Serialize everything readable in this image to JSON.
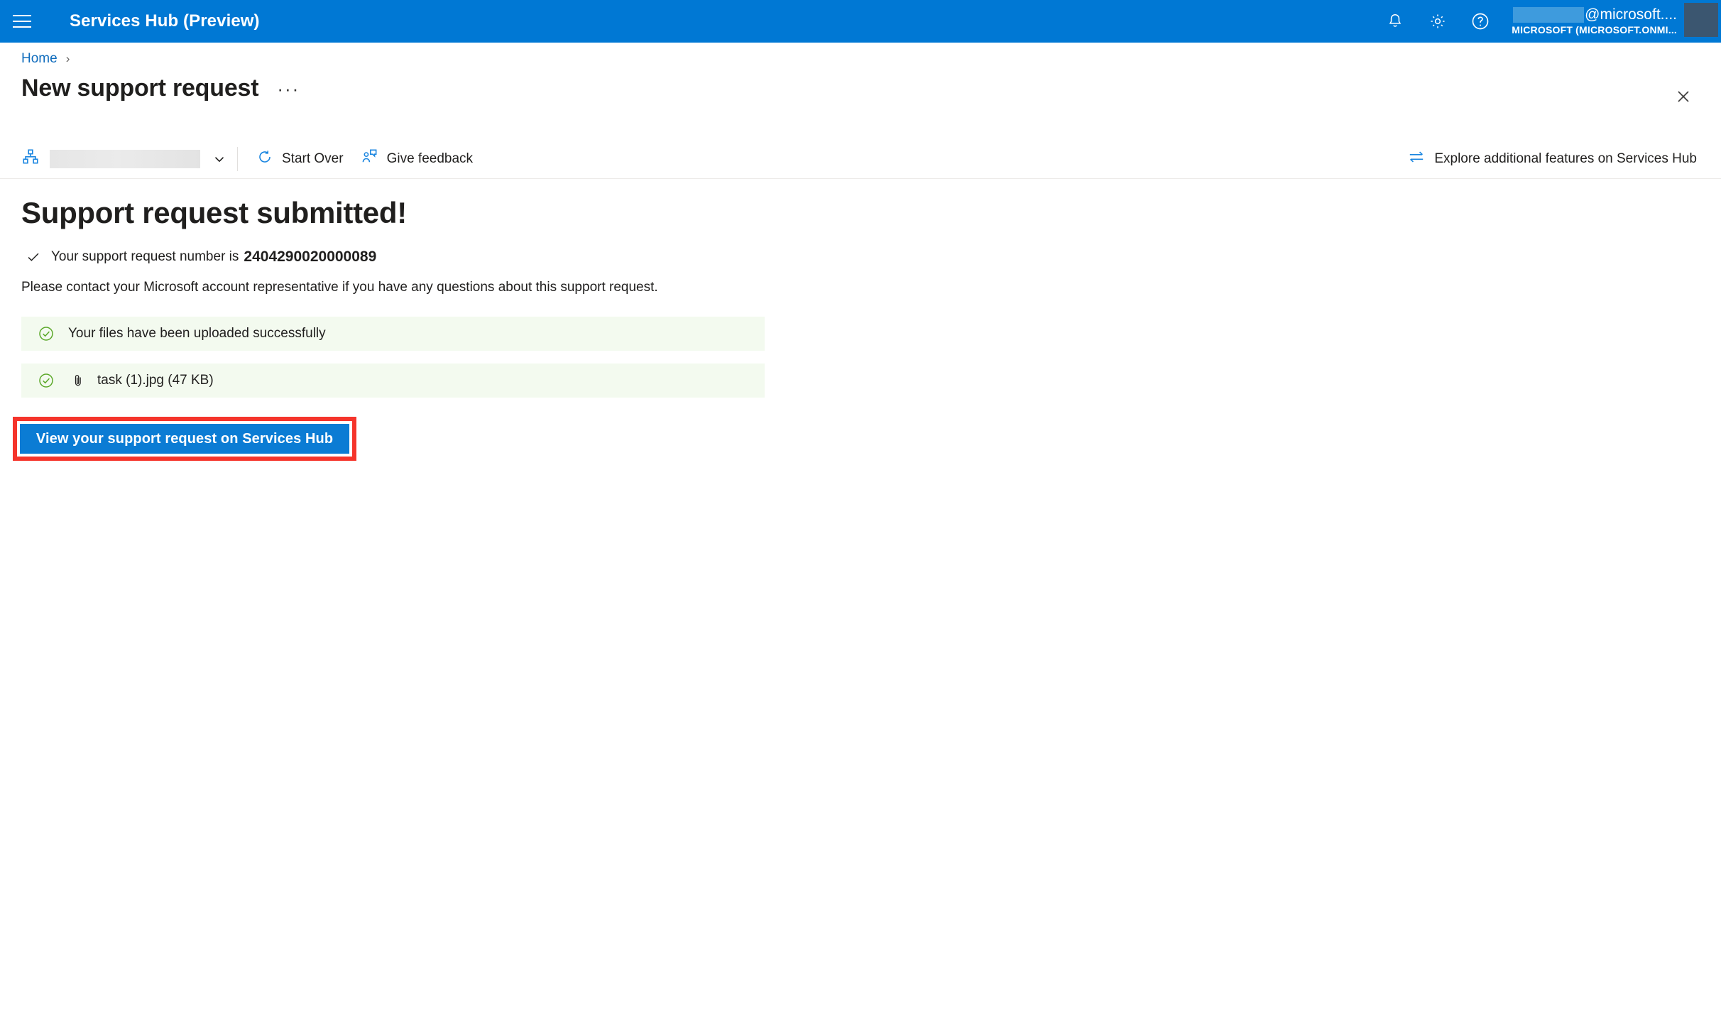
{
  "appbar": {
    "menu_icon": "hamburger-icon",
    "title": "Services Hub (Preview)",
    "icons": [
      {
        "name": "notifications-bell-icon",
        "label": "Notifications"
      },
      {
        "name": "settings-gear-icon",
        "label": "Settings"
      },
      {
        "name": "help-question-icon",
        "label": "Help"
      }
    ],
    "account": {
      "email": "@microsoft....",
      "email_redacted": true,
      "tenant": "MICROSOFT (MICROSOFT.ONMI...",
      "avatar": "user-avatar"
    }
  },
  "breadcrumb": {
    "home": "Home",
    "separator": "›"
  },
  "page": {
    "title": "New support request",
    "more_menu": "···",
    "close_icon": "close-icon"
  },
  "commandbar": {
    "org_selector": {
      "icon": "org-hierarchy-icon",
      "value": "",
      "value_redacted": true,
      "chevron": "chevron-down-icon"
    },
    "start_over": {
      "icon": "refresh-icon",
      "label": "Start Over"
    },
    "give_feedback": {
      "icon": "person-feedback-icon",
      "label": "Give feedback"
    },
    "explore": {
      "icon": "swap-arrows-icon",
      "label": "Explore additional features on Services Hub"
    }
  },
  "main": {
    "heading": "Support request submitted!",
    "request_line_prefix": "Your support request number is",
    "request_number": "2404290020000089",
    "contact_text": "Please contact your Microsoft account representative if you have any questions about this support request.",
    "upload_status": "Your files have been uploaded successfully",
    "file": {
      "icon": "paperclip-icon",
      "name_and_size": "task (1).jpg (47 KB)"
    },
    "cta_button": "View your support request on Services Hub"
  },
  "colors": {
    "brand_blue": "#0078d4",
    "button_blue": "#0b7cd4",
    "link_blue": "#0f6cbd",
    "success_green": "#5ba829",
    "success_bg": "#f3faef",
    "highlight_red": "#f5342b",
    "avatar": "#3b5670"
  }
}
